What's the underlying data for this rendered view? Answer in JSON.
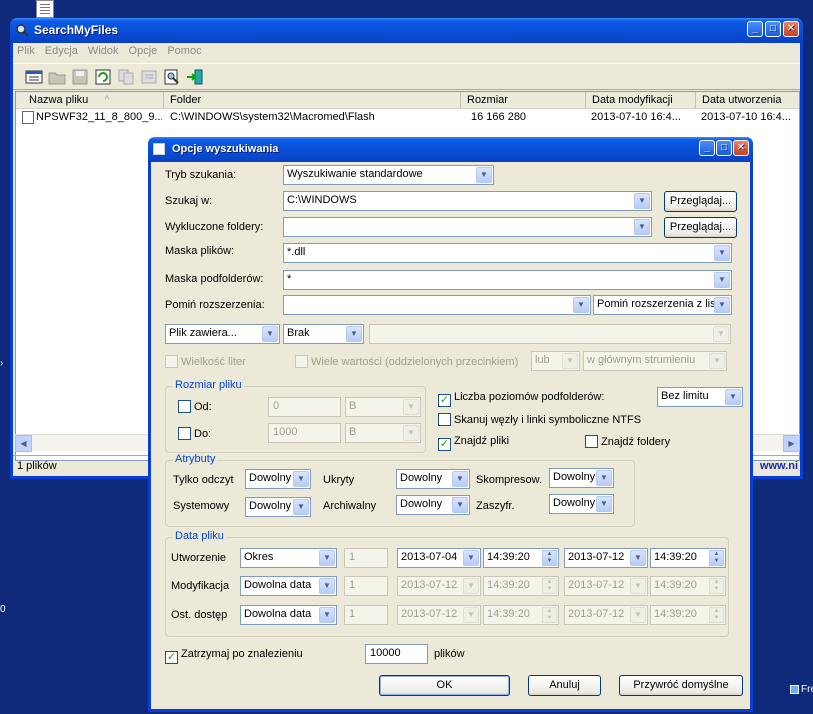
{
  "main_window": {
    "title": "SearchMyFiles",
    "menu": [
      "Plik",
      "Edycja",
      "Widok",
      "Opcje",
      "Pomoc"
    ],
    "columns": [
      "Nazwa pliku",
      "Folder",
      "Rozmiar",
      "Data modyfikacji",
      "Data utworzenia"
    ],
    "rows": [
      {
        "name": "NPSWF32_11_8_800_9...",
        "folder": "C:\\WINDOWS\\system32\\Macromed\\Flash",
        "size": "16 166 280",
        "modified": "2013-07-10 16:4...",
        "created": "2013-07-10 16:4..."
      }
    ],
    "status": "1 plików",
    "status_url": "www.ni"
  },
  "dialog": {
    "title": "Opcje wyszukiwania",
    "search_mode": {
      "label": "Tryb szukania:",
      "value": "Wyszukiwanie standardowe"
    },
    "search_in": {
      "label": "Szukaj w:",
      "value": "C:\\WINDOWS",
      "browse": "Przeglądaj..."
    },
    "excluded": {
      "label": "Wykluczone foldery:",
      "value": "",
      "browse": "Przeglądaj..."
    },
    "file_mask": {
      "label": "Maska plików:",
      "value": "*.dll"
    },
    "subfolder_mask": {
      "label": "Maska podfolderów:",
      "value": "*"
    },
    "skip_ext": {
      "label": "Pomiń rozszerzenia:",
      "value": "",
      "mode": "Pomiń rozszerzenia z listy"
    },
    "contains": {
      "mode": "Plik zawiera...",
      "type": "Brak",
      "value": ""
    },
    "case_sensitive": "Wielkość liter",
    "multi_values": "Wiele wartości (oddzielonych przecinkiem)",
    "logic": "lub",
    "stream": "w głównym strumieniu",
    "size_group": {
      "title": "Rozmiar pliku",
      "from_label": "Od:",
      "from_value": "0",
      "from_unit": "B",
      "to_label": "Do:",
      "to_value": "1000",
      "to_unit": "B"
    },
    "subfolder_levels": {
      "label": "Liczba poziomów podfolderów:",
      "value": "Bez limitu"
    },
    "scan_nodes": "Skanuj węzły i linki symboliczne NTFS",
    "find_files": "Znajdź pliki",
    "find_folders": "Znajdź foldery",
    "attributes": {
      "title": "Atrybuty",
      "readonly": {
        "label": "Tylko odczyt",
        "value": "Dowolny"
      },
      "hidden": {
        "label": "Ukryty",
        "value": "Dowolny"
      },
      "compressed": {
        "label": "Skompresow.",
        "value": "Dowolny"
      },
      "system": {
        "label": "Systemowy",
        "value": "Dowolny"
      },
      "archive": {
        "label": "Archiwalny",
        "value": "Dowolny"
      },
      "encrypted": {
        "label": "Zaszyfr.",
        "value": "Dowolny"
      }
    },
    "dates": {
      "title": "Data pliku",
      "created": {
        "label": "Utworzenie",
        "mode": "Okres",
        "n": "1",
        "from_date": "2013-07-04",
        "from_time": "14:39:20",
        "to_date": "2013-07-12",
        "to_time": "14:39:20"
      },
      "modified": {
        "label": "Modyfikacja",
        "mode": "Dowolna data",
        "n": "1",
        "from_date": "2013-07-12",
        "from_time": "14:39:20",
        "to_date": "2013-07-12",
        "to_time": "14:39:20"
      },
      "accessed": {
        "label": "Ost. dostęp",
        "mode": "Dowolna data",
        "n": "1",
        "from_date": "2013-07-12",
        "from_time": "14:39:20",
        "to_date": "2013-07-12",
        "to_time": "14:39:20"
      }
    },
    "stop_after": {
      "label": "Zatrzymaj po znalezieniu",
      "value": "10000",
      "suffix": "plików"
    },
    "buttons": {
      "ok": "OK",
      "cancel": "Anuluj",
      "defaults": "Przywróć domyślne"
    }
  },
  "taskbar_hint": "Fre"
}
